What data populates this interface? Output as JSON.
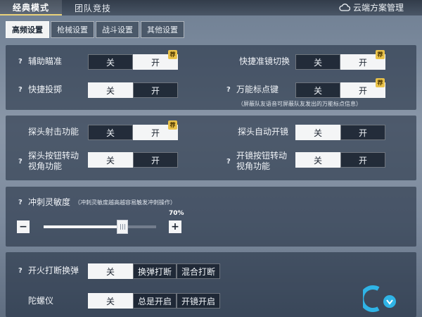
{
  "main_tabs": [
    {
      "label": "经典模式",
      "active": true
    },
    {
      "label": "团队竞技",
      "active": false
    }
  ],
  "cloud_label": "云端方案管理",
  "sub_tabs": [
    {
      "label": "高频设置",
      "active": true
    },
    {
      "label": "枪械设置",
      "active": false
    },
    {
      "label": "战斗设置",
      "active": false
    },
    {
      "label": "其他设置",
      "active": false
    }
  ],
  "common": {
    "off": "关",
    "on": "开",
    "recommend": "荐",
    "q": "?"
  },
  "settings": {
    "assist_aim": {
      "label": "辅助瞄准",
      "value": "开",
      "recommended": true
    },
    "quick_scope_switch": {
      "label": "快捷准镜切换",
      "value": "开",
      "recommended": true
    },
    "quick_throw": {
      "label": "快捷投掷",
      "value": "关"
    },
    "universal_marker": {
      "label": "万能标点键",
      "value": "开",
      "recommended": true,
      "note": "（屏蔽队友语音可屏蔽队友发出的万能标点信息）"
    },
    "peek_fire": {
      "label": "探头射击功能",
      "value": "开",
      "recommended": true
    },
    "peek_auto_scope": {
      "label": "探头自动开镜",
      "value": "关"
    },
    "peek_rotate_line1": "探头按钮转动",
    "peek_rotate_line2": "视角功能",
    "peek_rotate_value": "关",
    "scope_rotate_line1": "开镜按钮转动",
    "scope_rotate_line2": "视角功能",
    "scope_rotate_value": "关",
    "sprint_sensitivity": {
      "label": "冲刺灵敏度",
      "hint": "（冲刺灵敏度越高越容易触发冲刺操作）",
      "value_text": "70%",
      "value": 0.7
    },
    "fire_interrupt_reload": {
      "label": "开火打断换弹",
      "options": [
        "关",
        "换弹打断",
        "混合打断"
      ],
      "selected": "关"
    },
    "gyroscope": {
      "label": "陀螺仪",
      "options": [
        "关",
        "总是开启",
        "开镜开启"
      ],
      "selected": "关"
    }
  }
}
